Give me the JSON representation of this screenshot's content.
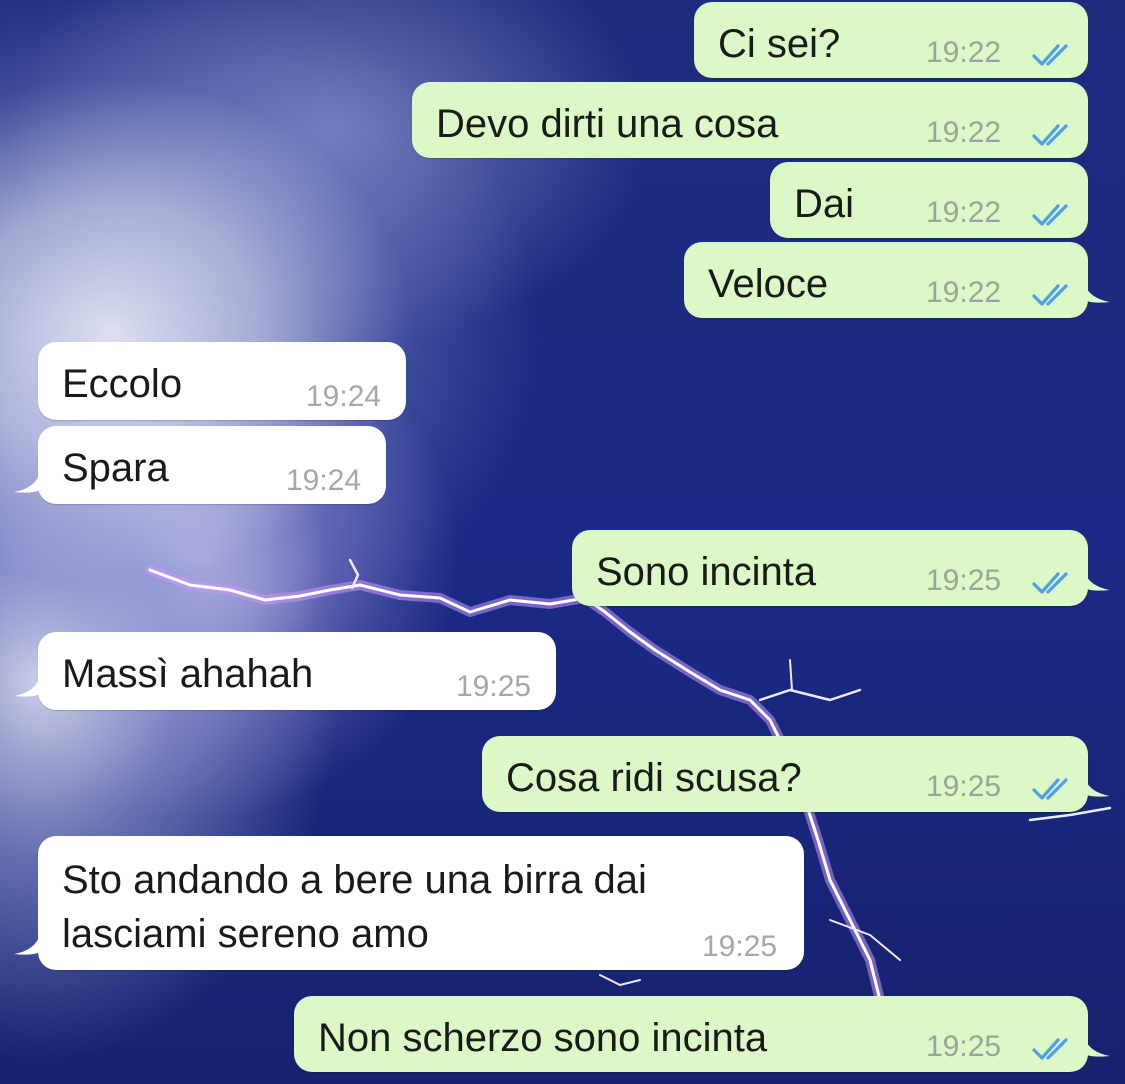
{
  "colors": {
    "outgoing_bubble": "#dcf8c6",
    "incoming_bubble": "#ffffff",
    "read_check": "#4f9fe8",
    "timestamp": "#9aa49a"
  },
  "messages": [
    {
      "direction": "outgoing",
      "text": "Ci sei?",
      "time": "19:22",
      "status_icon": "double-check-read-icon"
    },
    {
      "direction": "outgoing",
      "text": "Devo dirti una cosa",
      "time": "19:22",
      "status_icon": "double-check-read-icon"
    },
    {
      "direction": "outgoing",
      "text": "Dai",
      "time": "19:22",
      "status_icon": "double-check-read-icon"
    },
    {
      "direction": "outgoing",
      "text": "Veloce",
      "time": "19:22",
      "status_icon": "double-check-read-icon"
    },
    {
      "direction": "incoming",
      "text": "Eccolo",
      "time": "19:24"
    },
    {
      "direction": "incoming",
      "text": "Spara",
      "time": "19:24"
    },
    {
      "direction": "outgoing",
      "text": "Sono incinta",
      "time": "19:25",
      "status_icon": "double-check-read-icon"
    },
    {
      "direction": "incoming",
      "text": "Massì ahahah",
      "time": "19:25"
    },
    {
      "direction": "outgoing",
      "text": "Cosa ridi scusa?",
      "time": "19:25",
      "status_icon": "double-check-read-icon"
    },
    {
      "direction": "incoming",
      "text_line1": "Sto andando a bere una birra dai",
      "text_line2": "lasciami sereno amo",
      "time": "19:25"
    },
    {
      "direction": "outgoing",
      "text": "Non scherzo sono incinta",
      "time": "19:25",
      "status_icon": "double-check-read-icon"
    }
  ]
}
